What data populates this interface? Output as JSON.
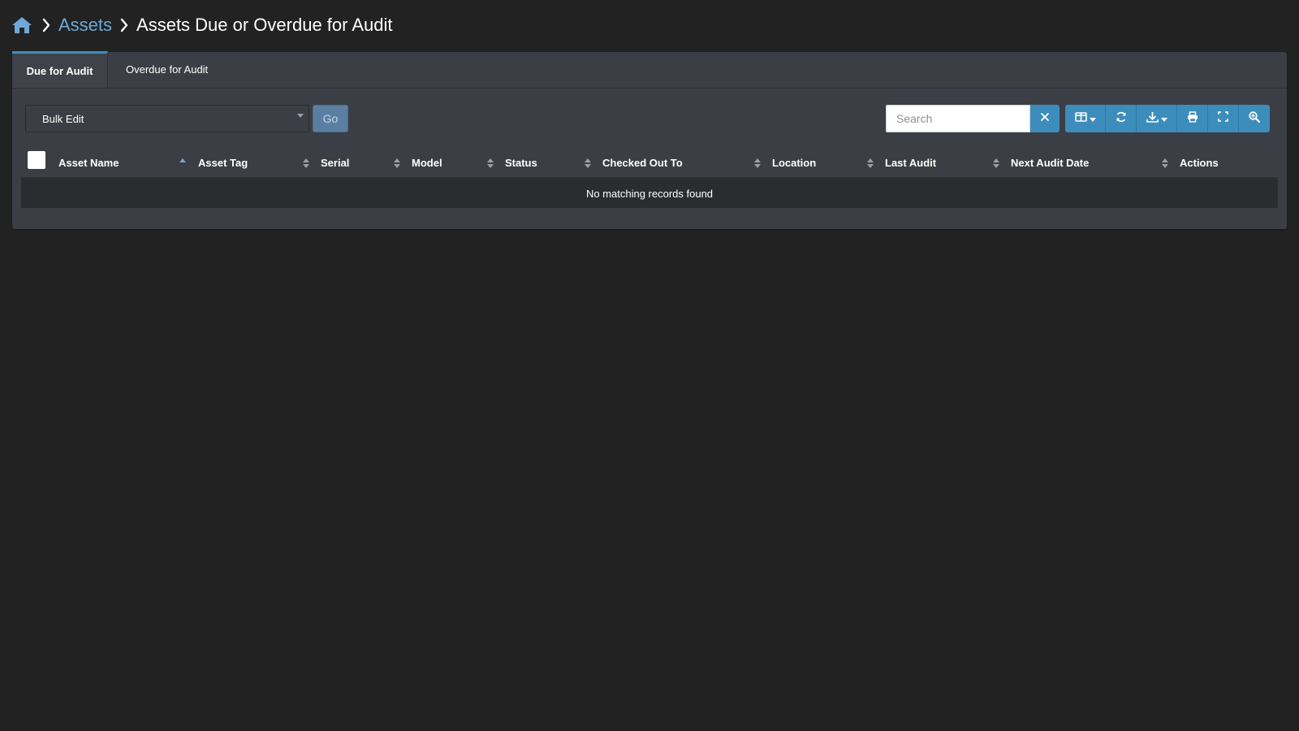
{
  "breadcrumb": {
    "home_icon": "home-icon",
    "link": "Assets",
    "current": "Assets Due or Overdue for Audit"
  },
  "tabs": [
    {
      "label": "Due for Audit",
      "active": true
    },
    {
      "label": "Overdue for Audit",
      "active": false
    }
  ],
  "toolbar": {
    "bulk_select_value": "Bulk Edit",
    "go_label": "Go",
    "search_placeholder": "Search",
    "icons": [
      "clear-icon",
      "columns-icon",
      "refresh-icon",
      "export-icon",
      "print-icon",
      "fullscreen-icon",
      "advanced-search-icon"
    ]
  },
  "table": {
    "columns": [
      "Asset Name",
      "Asset Tag",
      "Serial",
      "Model",
      "Status",
      "Checked Out To",
      "Location",
      "Last Audit",
      "Next Audit Date",
      "Actions"
    ],
    "empty_message": "No matching records found"
  },
  "colors": {
    "background": "#222222",
    "panel": "#3b3e44",
    "accent": "#3c8dbc",
    "link": "#6fa8d6"
  }
}
